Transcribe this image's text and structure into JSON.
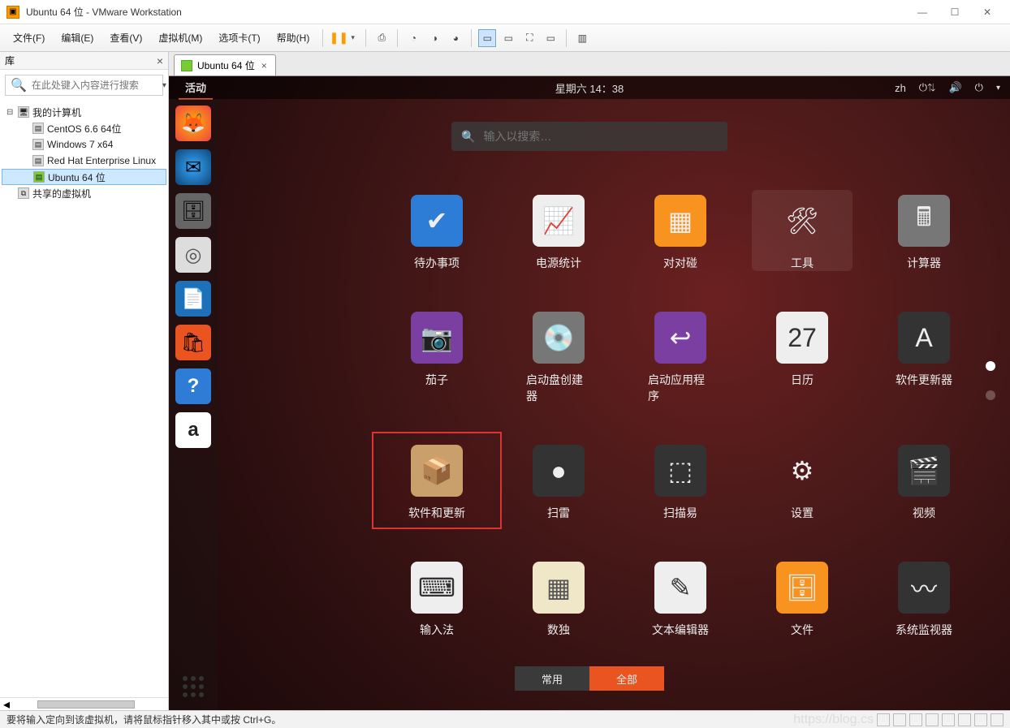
{
  "window": {
    "title": "Ubuntu 64 位 - VMware Workstation"
  },
  "menus": {
    "file": "文件(F)",
    "edit": "编辑(E)",
    "view": "查看(V)",
    "vm": "虚拟机(M)",
    "tabs": "选项卡(T)",
    "help": "帮助(H)"
  },
  "library": {
    "title": "库",
    "search_placeholder": "在此处键入内容进行搜索",
    "my_computer": "我的计算机",
    "items": [
      {
        "label": "CentOS 6.6 64位"
      },
      {
        "label": "Windows 7 x64"
      },
      {
        "label": "Red Hat Enterprise Linux"
      },
      {
        "label": "Ubuntu 64 位"
      }
    ],
    "shared": "共享的虚拟机"
  },
  "tab": {
    "label": "Ubuntu 64 位"
  },
  "ubuntu": {
    "activities": "活动",
    "clock": "星期六 14：38",
    "lang": "zh",
    "search_placeholder": "输入以搜索…",
    "apps": [
      {
        "label": "待办事项",
        "glyph": "✔",
        "bg": "bg-blue"
      },
      {
        "label": "电源统计",
        "glyph": "📈",
        "bg": "bg-white"
      },
      {
        "label": "对对碰",
        "glyph": "▦",
        "bg": "bg-orange"
      },
      {
        "label": "工具",
        "glyph": "🛠",
        "bg": "",
        "selected": true
      },
      {
        "label": "计算器",
        "glyph": "🖩",
        "bg": "bg-grey"
      },
      {
        "label": "茄子",
        "glyph": "📷",
        "bg": "bg-purple"
      },
      {
        "label": "启动盘创建器",
        "glyph": "💿",
        "bg": "bg-grey"
      },
      {
        "label": "启动应用程序",
        "glyph": "↩",
        "bg": "bg-purple"
      },
      {
        "label": "日历",
        "glyph": "27",
        "bg": "bg-white"
      },
      {
        "label": "软件更新器",
        "glyph": "A",
        "bg": "bg-dark"
      },
      {
        "label": "软件和更新",
        "glyph": "📦",
        "bg": "bg-box",
        "highlight": true
      },
      {
        "label": "扫雷",
        "glyph": "●",
        "bg": "bg-dark"
      },
      {
        "label": "扫描易",
        "glyph": "⬚",
        "bg": "bg-dark"
      },
      {
        "label": "设置",
        "glyph": "⚙",
        "bg": ""
      },
      {
        "label": "视频",
        "glyph": "🎬",
        "bg": "bg-dark"
      },
      {
        "label": "输入法",
        "glyph": "⌨",
        "bg": "bg-white"
      },
      {
        "label": "数独",
        "glyph": "▦",
        "bg": "bg-cream"
      },
      {
        "label": "文本编辑器",
        "glyph": "✎",
        "bg": "bg-white"
      },
      {
        "label": "文件",
        "glyph": "🗄",
        "bg": "bg-orange"
      },
      {
        "label": "系统监视器",
        "glyph": "〰",
        "bg": "bg-dark"
      }
    ],
    "filter": {
      "frequent": "常用",
      "all": "全部"
    },
    "dock": [
      {
        "name": "firefox",
        "glyph": "🦊",
        "color": "#ff7b00"
      },
      {
        "name": "thunderbird",
        "glyph": "✉",
        "color": "#1e5aa8"
      },
      {
        "name": "files",
        "glyph": "🗄",
        "color": "#888"
      },
      {
        "name": "rhythmbox",
        "glyph": "◎",
        "color": "#ccc"
      },
      {
        "name": "writer",
        "glyph": "📄",
        "color": "#1e70b8"
      },
      {
        "name": "software",
        "glyph": "🛍",
        "color": "#e95420"
      },
      {
        "name": "help",
        "glyph": "?",
        "color": "#2e7cd6"
      },
      {
        "name": "amazon",
        "glyph": "a",
        "color": "#fff"
      }
    ]
  },
  "status": {
    "msg": "要将输入定向到该虚拟机，请将鼠标指针移入其中或按 Ctrl+G。",
    "watermark": "https://blog.cs"
  }
}
